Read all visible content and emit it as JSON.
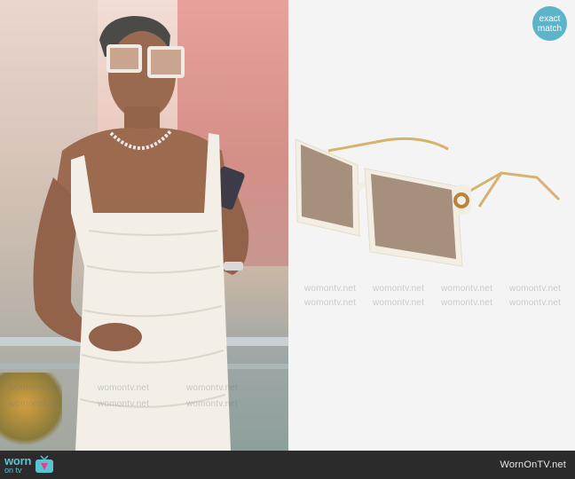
{
  "badge": {
    "line1": "exact",
    "line2": "match"
  },
  "footer": {
    "logo_worn": "worn",
    "logo_ontv": "on tv",
    "site_name": "WornOnTV.net"
  },
  "watermark_text": "womontv.net",
  "colors": {
    "accent": "#5bb4c8",
    "footer_bg": "#2b2b2b",
    "frame": "#f3eee2",
    "lens": "#a78f7e"
  }
}
